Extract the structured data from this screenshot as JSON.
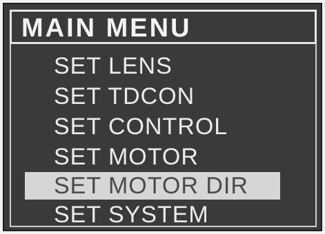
{
  "menu": {
    "title": "MAIN MENU",
    "items": [
      {
        "label": "SET LENS",
        "selected": false
      },
      {
        "label": "SET TDCON",
        "selected": false
      },
      {
        "label": "SET CONTROL",
        "selected": false
      },
      {
        "label": "SET MOTOR",
        "selected": false
      },
      {
        "label": "SET MOTOR DIR",
        "selected": true
      },
      {
        "label": "SET SYSTEM",
        "selected": false
      }
    ]
  },
  "colors": {
    "background": "#3a3a3a",
    "text": "#ececec",
    "highlight": "#d6d6d6",
    "highlight_text": "#4a4a4a"
  }
}
